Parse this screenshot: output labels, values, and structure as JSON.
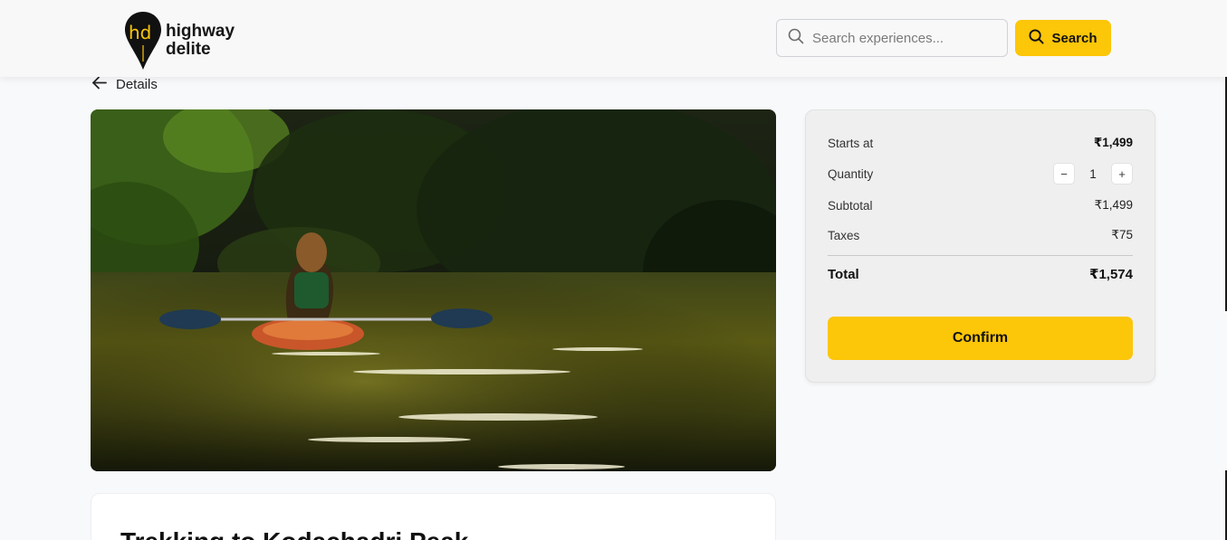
{
  "brand": {
    "logo_mark": "hd",
    "name_line1": "highway",
    "name_line2": "delite",
    "accent_color": "#fcc609"
  },
  "header": {
    "search_placeholder": "Search experiences...",
    "search_button_label": "Search",
    "search_icon": "search-icon"
  },
  "nav": {
    "back_label": "Details",
    "back_icon": "arrow-left-icon"
  },
  "hero": {
    "image_subject": "kayak-on-river"
  },
  "booking": {
    "starts_at_label": "Starts at",
    "starts_at_value": "₹1,499",
    "quantity_label": "Quantity",
    "quantity_value": "1",
    "decrement_symbol": "−",
    "increment_symbol": "+",
    "subtotal_label": "Subtotal",
    "subtotal_value": "₹1,499",
    "taxes_label": "Taxes",
    "taxes_value": "₹75",
    "total_label": "Total",
    "total_value": "₹1,574",
    "confirm_label": "Confirm"
  },
  "experience": {
    "title": "Trekking to Kodachadri Peak"
  }
}
